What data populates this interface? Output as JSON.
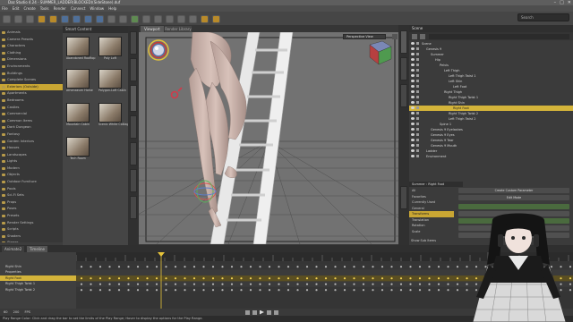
{
  "window": {
    "title": "Daz Studio 4.24 - SUMMER_LADDER(BLOCKED)(SideStone).duf",
    "controls": [
      "–",
      "□",
      "✕"
    ]
  },
  "menu": [
    "File",
    "Edit",
    "Create",
    "Tools",
    "Render",
    "Connect",
    "Window",
    "Help"
  ],
  "toolbar": {
    "search_placeholder": "Search"
  },
  "library": {
    "header": "Smart Content",
    "tree": [
      {
        "label": "Animals"
      },
      {
        "label": "Camera Presets"
      },
      {
        "label": "Characters"
      },
      {
        "label": "Clothing"
      },
      {
        "label": "Dimensions"
      },
      {
        "label": "Environments"
      },
      {
        "label": "Buildings"
      },
      {
        "label": "Complete Scenes"
      },
      {
        "label": "Exteriors (Outside)",
        "selected": true
      },
      {
        "label": "Apartments"
      },
      {
        "label": "Bedrooms"
      },
      {
        "label": "Castles"
      },
      {
        "label": "Commercial"
      },
      {
        "label": "Common Items"
      },
      {
        "label": "Dark Dungeon"
      },
      {
        "label": "Fantasy"
      },
      {
        "label": "Garden Interiors"
      },
      {
        "label": "Houses"
      },
      {
        "label": "Landscapes"
      },
      {
        "label": "Lights"
      },
      {
        "label": "Modern"
      },
      {
        "label": "Objects"
      },
      {
        "label": "Outdoor Furniture"
      },
      {
        "label": "Pools"
      },
      {
        "label": "Sci-Fi Sets"
      },
      {
        "label": "Props"
      },
      {
        "label": "Poses"
      },
      {
        "label": "Presets"
      },
      {
        "label": "Render Settings"
      },
      {
        "label": "Scripts"
      },
      {
        "label": "Shaders"
      },
      {
        "label": "Stages"
      },
      {
        "label": "Vehicles"
      }
    ],
    "thumbnails": [
      {
        "caption": "Abandoned Rooftop"
      },
      {
        "caption": "Poly Loft"
      },
      {
        "caption": "Athenaeum Home"
      },
      {
        "caption": "Polygon-Loft Cabin"
      },
      {
        "caption": "Mountain Cabin"
      },
      {
        "caption": "Scenic White Cottage"
      },
      {
        "caption": "Tech Room"
      }
    ]
  },
  "viewport": {
    "tabs": [
      "Viewport",
      "Render Library"
    ],
    "camera_select": "Perspective View"
  },
  "scene": {
    "header": "Scene",
    "rows": [
      {
        "label": "Scene",
        "indent": 0
      },
      {
        "label": "Genesis 9",
        "indent": 1
      },
      {
        "label": "Summer",
        "indent": 2
      },
      {
        "label": "Hip",
        "indent": 3
      },
      {
        "label": "Pelvis",
        "indent": 4
      },
      {
        "label": "Left Thigh",
        "indent": 5
      },
      {
        "label": "Left Thigh Twist 1",
        "indent": 6
      },
      {
        "label": "Left Shin",
        "indent": 6
      },
      {
        "label": "Left Foot",
        "indent": 7
      },
      {
        "label": "Right Thigh",
        "indent": 5
      },
      {
        "label": "Right Thigh Twist 1",
        "indent": 6
      },
      {
        "label": "Right Shin",
        "indent": 6
      },
      {
        "label": "Right Foot",
        "indent": 7,
        "selected": true
      },
      {
        "label": "Right Thigh Twist 2",
        "indent": 6
      },
      {
        "label": "Left Thigh Twist 2",
        "indent": 6
      },
      {
        "label": "Spine 1",
        "indent": 4
      },
      {
        "label": "Genesis 9 Eyelashes",
        "indent": 2
      },
      {
        "label": "Genesis 9 Eyes",
        "indent": 2
      },
      {
        "label": "Genesis 9 Tear",
        "indent": 2
      },
      {
        "label": "Genesis 9 Mouth",
        "indent": 2
      },
      {
        "label": "Ladder",
        "indent": 1
      },
      {
        "label": "Environment",
        "indent": 1
      }
    ]
  },
  "parameters": {
    "node_select": "Summer : Right Foot",
    "categories": [
      {
        "label": "All"
      },
      {
        "label": "Favorites"
      },
      {
        "label": "Currently Used"
      },
      {
        "label": "General"
      },
      {
        "label": "Transforms",
        "selected": true
      },
      {
        "label": "Translation"
      },
      {
        "label": "Rotation"
      },
      {
        "label": "Scale"
      }
    ],
    "show_sub_items": "Show Sub Items",
    "buttons": [
      "Create Custom Parameter",
      "Edit Mode"
    ]
  },
  "timeline": {
    "tabs": [
      "Animate2",
      "Timeline"
    ],
    "tracks": [
      {
        "label": "Right Shin"
      },
      {
        "label": "Properties"
      },
      {
        "label": "Right Foot",
        "selected": true
      },
      {
        "label": "Right Thigh Twist 1"
      },
      {
        "label": "Right Thigh Twist 2"
      }
    ],
    "current_frame": "60",
    "total_frames": "200",
    "fps_label": "FPS"
  },
  "status": "Play Range Color: Click and drag the bar to set the limits of the Play Range; Hover to display the options for the Play Range."
}
